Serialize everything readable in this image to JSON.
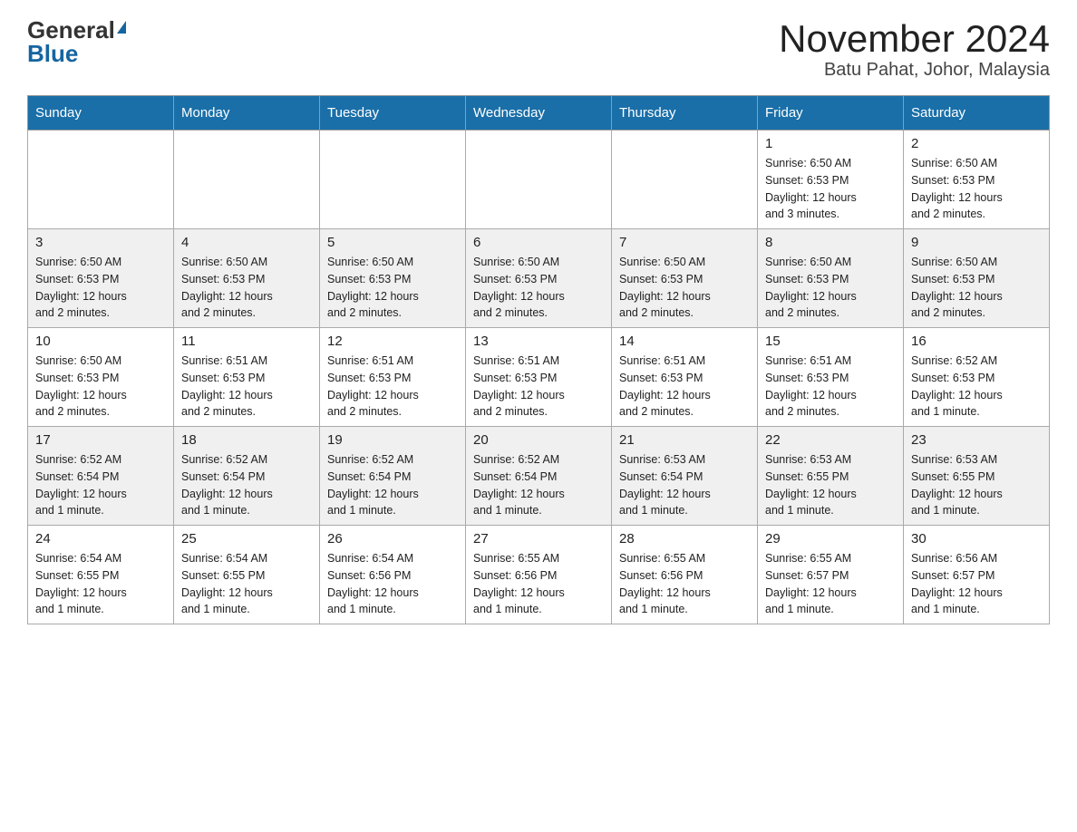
{
  "header": {
    "logo_general": "General",
    "logo_blue": "Blue",
    "month_title": "November 2024",
    "location": "Batu Pahat, Johor, Malaysia"
  },
  "weekdays": [
    "Sunday",
    "Monday",
    "Tuesday",
    "Wednesday",
    "Thursday",
    "Friday",
    "Saturday"
  ],
  "weeks": [
    [
      {
        "day": "",
        "info": ""
      },
      {
        "day": "",
        "info": ""
      },
      {
        "day": "",
        "info": ""
      },
      {
        "day": "",
        "info": ""
      },
      {
        "day": "",
        "info": ""
      },
      {
        "day": "1",
        "info": "Sunrise: 6:50 AM\nSunset: 6:53 PM\nDaylight: 12 hours\nand 3 minutes."
      },
      {
        "day": "2",
        "info": "Sunrise: 6:50 AM\nSunset: 6:53 PM\nDaylight: 12 hours\nand 2 minutes."
      }
    ],
    [
      {
        "day": "3",
        "info": "Sunrise: 6:50 AM\nSunset: 6:53 PM\nDaylight: 12 hours\nand 2 minutes."
      },
      {
        "day": "4",
        "info": "Sunrise: 6:50 AM\nSunset: 6:53 PM\nDaylight: 12 hours\nand 2 minutes."
      },
      {
        "day": "5",
        "info": "Sunrise: 6:50 AM\nSunset: 6:53 PM\nDaylight: 12 hours\nand 2 minutes."
      },
      {
        "day": "6",
        "info": "Sunrise: 6:50 AM\nSunset: 6:53 PM\nDaylight: 12 hours\nand 2 minutes."
      },
      {
        "day": "7",
        "info": "Sunrise: 6:50 AM\nSunset: 6:53 PM\nDaylight: 12 hours\nand 2 minutes."
      },
      {
        "day": "8",
        "info": "Sunrise: 6:50 AM\nSunset: 6:53 PM\nDaylight: 12 hours\nand 2 minutes."
      },
      {
        "day": "9",
        "info": "Sunrise: 6:50 AM\nSunset: 6:53 PM\nDaylight: 12 hours\nand 2 minutes."
      }
    ],
    [
      {
        "day": "10",
        "info": "Sunrise: 6:50 AM\nSunset: 6:53 PM\nDaylight: 12 hours\nand 2 minutes."
      },
      {
        "day": "11",
        "info": "Sunrise: 6:51 AM\nSunset: 6:53 PM\nDaylight: 12 hours\nand 2 minutes."
      },
      {
        "day": "12",
        "info": "Sunrise: 6:51 AM\nSunset: 6:53 PM\nDaylight: 12 hours\nand 2 minutes."
      },
      {
        "day": "13",
        "info": "Sunrise: 6:51 AM\nSunset: 6:53 PM\nDaylight: 12 hours\nand 2 minutes."
      },
      {
        "day": "14",
        "info": "Sunrise: 6:51 AM\nSunset: 6:53 PM\nDaylight: 12 hours\nand 2 minutes."
      },
      {
        "day": "15",
        "info": "Sunrise: 6:51 AM\nSunset: 6:53 PM\nDaylight: 12 hours\nand 2 minutes."
      },
      {
        "day": "16",
        "info": "Sunrise: 6:52 AM\nSunset: 6:53 PM\nDaylight: 12 hours\nand 1 minute."
      }
    ],
    [
      {
        "day": "17",
        "info": "Sunrise: 6:52 AM\nSunset: 6:54 PM\nDaylight: 12 hours\nand 1 minute."
      },
      {
        "day": "18",
        "info": "Sunrise: 6:52 AM\nSunset: 6:54 PM\nDaylight: 12 hours\nand 1 minute."
      },
      {
        "day": "19",
        "info": "Sunrise: 6:52 AM\nSunset: 6:54 PM\nDaylight: 12 hours\nand 1 minute."
      },
      {
        "day": "20",
        "info": "Sunrise: 6:52 AM\nSunset: 6:54 PM\nDaylight: 12 hours\nand 1 minute."
      },
      {
        "day": "21",
        "info": "Sunrise: 6:53 AM\nSunset: 6:54 PM\nDaylight: 12 hours\nand 1 minute."
      },
      {
        "day": "22",
        "info": "Sunrise: 6:53 AM\nSunset: 6:55 PM\nDaylight: 12 hours\nand 1 minute."
      },
      {
        "day": "23",
        "info": "Sunrise: 6:53 AM\nSunset: 6:55 PM\nDaylight: 12 hours\nand 1 minute."
      }
    ],
    [
      {
        "day": "24",
        "info": "Sunrise: 6:54 AM\nSunset: 6:55 PM\nDaylight: 12 hours\nand 1 minute."
      },
      {
        "day": "25",
        "info": "Sunrise: 6:54 AM\nSunset: 6:55 PM\nDaylight: 12 hours\nand 1 minute."
      },
      {
        "day": "26",
        "info": "Sunrise: 6:54 AM\nSunset: 6:56 PM\nDaylight: 12 hours\nand 1 minute."
      },
      {
        "day": "27",
        "info": "Sunrise: 6:55 AM\nSunset: 6:56 PM\nDaylight: 12 hours\nand 1 minute."
      },
      {
        "day": "28",
        "info": "Sunrise: 6:55 AM\nSunset: 6:56 PM\nDaylight: 12 hours\nand 1 minute."
      },
      {
        "day": "29",
        "info": "Sunrise: 6:55 AM\nSunset: 6:57 PM\nDaylight: 12 hours\nand 1 minute."
      },
      {
        "day": "30",
        "info": "Sunrise: 6:56 AM\nSunset: 6:57 PM\nDaylight: 12 hours\nand 1 minute."
      }
    ]
  ]
}
